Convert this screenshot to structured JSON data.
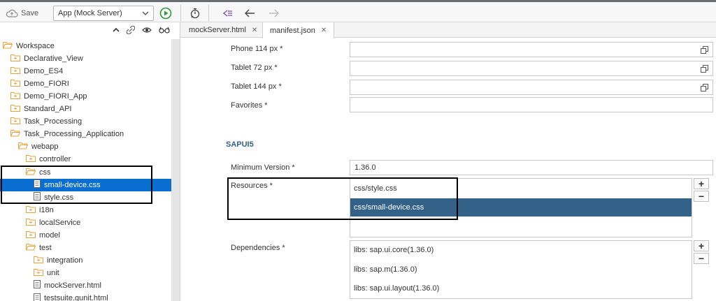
{
  "toolbar": {
    "save_label": "Save",
    "app_select": "App (Mock Server)"
  },
  "tree": {
    "items": [
      {
        "label": "Workspace"
      },
      {
        "label": "Declarative_View"
      },
      {
        "label": "Demo_ES4"
      },
      {
        "label": "Demo_FIORI"
      },
      {
        "label": "Demo_FIORI_App"
      },
      {
        "label": "Standard_API"
      },
      {
        "label": "Task_Processing"
      },
      {
        "label": "Task_Processing_Application"
      },
      {
        "label": "webapp"
      },
      {
        "label": "controller"
      },
      {
        "label": "css"
      },
      {
        "label": "small-device.css"
      },
      {
        "label": "style.css"
      },
      {
        "label": "i18n"
      },
      {
        "label": "localService"
      },
      {
        "label": "model"
      },
      {
        "label": "test"
      },
      {
        "label": "integration"
      },
      {
        "label": "unit"
      },
      {
        "label": "mockServer.html"
      },
      {
        "label": "testsuite.qunit.html"
      }
    ]
  },
  "tabs": [
    {
      "label": "mockServer.html"
    },
    {
      "label": "manifest.json"
    }
  ],
  "form": {
    "phone114": {
      "label": "Phone 114 px *",
      "value": ""
    },
    "tablet72": {
      "label": "Tablet 72 px *",
      "value": ""
    },
    "tablet144": {
      "label": "Tablet 144 px *",
      "value": ""
    },
    "favorites": {
      "label": "Favorites *",
      "value": ""
    },
    "section_title": "SAPUI5",
    "min_version": {
      "label": "Minimum Version *",
      "value": "1.36.0"
    },
    "resources": {
      "label": "Resources *",
      "items": [
        "css/style.css",
        "css/small-device.css"
      ]
    },
    "dependencies": {
      "label": "Dependencies *",
      "items": [
        "libs: sap.ui.core(1.36.0)",
        "libs: sap.m(1.36.0)",
        "libs: sap.ui.layout(1.36.0)"
      ]
    },
    "plus_glyph": "+",
    "minus_glyph": "−"
  },
  "colors": {
    "tree_selected": "#0a6ed1",
    "list_selected": "#346187",
    "folder_orange": "#e8a33d",
    "run_green": "#2b9a3b"
  },
  "icons": [
    "cloud-save-icon",
    "chevron-down-icon",
    "run-icon",
    "stopwatch-icon",
    "tree-icon",
    "back-icon",
    "forward-icon",
    "collapse-icon",
    "link-icon",
    "eye-icon",
    "glasses-icon",
    "folder-icon",
    "file-icon",
    "value-help-icon"
  ]
}
